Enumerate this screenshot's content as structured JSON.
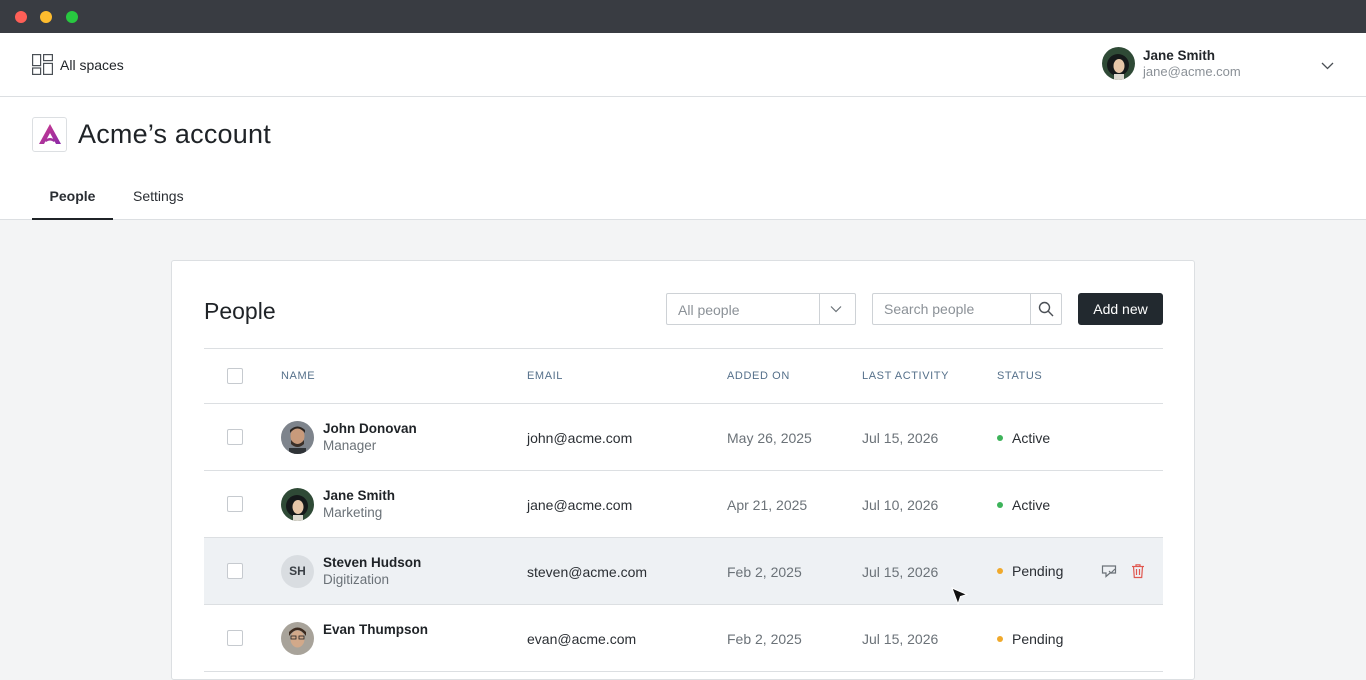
{
  "window": {
    "colors": {
      "red": "#fe5f57",
      "yellow": "#febc2e",
      "green": "#28c840"
    }
  },
  "topnav": {
    "spaces_label": "All spaces",
    "spaces_icon": "grid-icon",
    "user": {
      "name": "Jane Smith",
      "email": "jane@acme.com"
    }
  },
  "header": {
    "title": "Acme’s account",
    "logo": "acme-logo",
    "tabs": [
      {
        "label": "People",
        "active": true
      },
      {
        "label": "Settings",
        "active": false
      }
    ]
  },
  "people": {
    "title": "People",
    "filter": {
      "value": "All people"
    },
    "search": {
      "placeholder": "Search people"
    },
    "add_label": "Add new",
    "columns": [
      "NAME",
      "EMAIL",
      "ADDED ON",
      "LAST ACTIVITY",
      "STATUS"
    ],
    "rows": [
      {
        "name": "John Donovan",
        "role": "Manager",
        "email": "john@acme.com",
        "added": "May 26, 2025",
        "last": "Jul 15, 2026",
        "status": "Active"
      },
      {
        "name": "Jane Smith",
        "role": "Marketing",
        "email": "jane@acme.com",
        "added": "Apr 21, 2025",
        "last": "Jul 10, 2026",
        "status": "Active"
      },
      {
        "name": "Steven Hudson",
        "initials": "SH",
        "role": "Digitization",
        "email": "steven@acme.com",
        "added": "Feb 2, 2025",
        "last": "Jul 15, 2026",
        "status": "Pending"
      },
      {
        "name": "Evan Thumpson",
        "role": "",
        "email": "evan@acme.com",
        "added": "Feb 2, 2025",
        "last": "Jul 15, 2026",
        "status": "Pending"
      }
    ],
    "status_colors": {
      "Active": "#3db35a",
      "Pending": "#f0a92b"
    }
  }
}
